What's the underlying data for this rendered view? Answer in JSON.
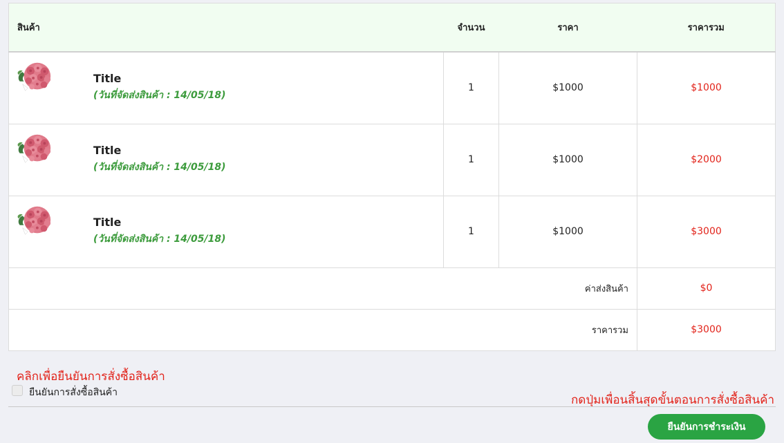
{
  "table": {
    "headers": {
      "product": "สินค้า",
      "quantity": "จำนวน",
      "price": "ราคา",
      "total": "ราคารวม"
    },
    "items": [
      {
        "title": "Title",
        "delivery": "(วันที่จัดส่งสินค้า : 14/05/18)",
        "qty": "1",
        "price": "$1000",
        "total": "$1000",
        "thumb_icon": "rose-bouquet-icon"
      },
      {
        "title": "Title",
        "delivery": "(วันที่จัดส่งสินค้า : 14/05/18)",
        "qty": "1",
        "price": "$1000",
        "total": "$2000",
        "thumb_icon": "rose-bouquet-icon"
      },
      {
        "title": "Title",
        "delivery": "(วันที่จัดส่งสินค้า : 14/05/18)",
        "qty": "1",
        "price": "$1000",
        "total": "$3000",
        "thumb_icon": "rose-bouquet-icon"
      }
    ],
    "shipping": {
      "label": "ค่าส่งสินค้า",
      "value": "$0"
    },
    "grand_total": {
      "label": "ราคารวม",
      "value": "$3000"
    }
  },
  "confirm": {
    "heading": "คลิกเพื่อยืนยันการสั่งซื้อสินค้า",
    "checkbox_label": "ยืนยันการสั่งซื้อสินค้า",
    "finish_note": "กดปุ่มเพื่อนสิ้นสุดขั้นตอนการสั่งซื้อสินค้า",
    "pay_button": "ยืนยันการชำระเงิน"
  },
  "colors": {
    "accent_red": "#e2231a",
    "accent_green": "#2aa443",
    "date_green": "#3c9b3c",
    "header_bg": "#f1fdf1"
  }
}
